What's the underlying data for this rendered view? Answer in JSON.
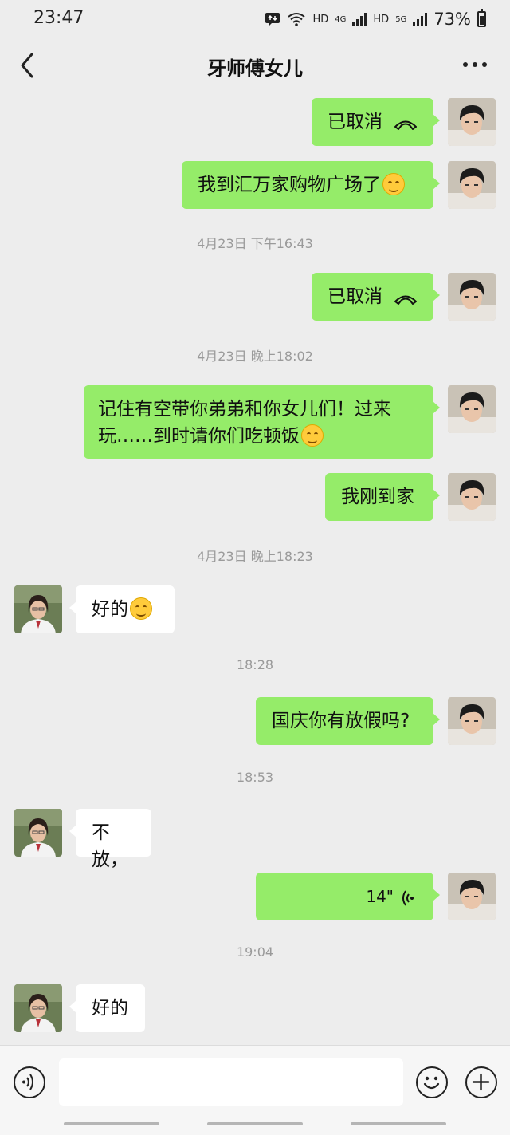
{
  "status_bar": {
    "time": "23:47",
    "hd1": "HD",
    "net1": "4G",
    "hd2": "HD",
    "net2": "5G",
    "battery": "73%"
  },
  "header": {
    "title": "牙师傅女儿"
  },
  "messages": [
    {
      "from": "me",
      "type": "call",
      "text": "已取消"
    },
    {
      "from": "me",
      "type": "text",
      "text": "我到汇万家购物广场了",
      "emoji": true
    },
    {
      "type": "time",
      "text": "4月23日 下午16:43"
    },
    {
      "from": "me",
      "type": "call",
      "text": "已取消"
    },
    {
      "type": "time",
      "text": "4月23日 晚上18:02"
    },
    {
      "from": "me",
      "type": "text",
      "lines": [
        "记住有空带你弟弟和你女儿们！过来",
        "玩……到时请你们吃顿饭"
      ],
      "emoji": true
    },
    {
      "from": "me",
      "type": "text",
      "text": "我刚到家"
    },
    {
      "type": "time",
      "text": "4月23日 晚上18:23"
    },
    {
      "from": "her",
      "type": "text",
      "text": "好的",
      "emoji": true
    },
    {
      "type": "time",
      "text": "18:28"
    },
    {
      "from": "me",
      "type": "text",
      "text": "国庆你有放假吗?"
    },
    {
      "type": "time",
      "text": "18:53"
    },
    {
      "from": "her",
      "type": "text",
      "text": "不放，"
    },
    {
      "from": "me",
      "type": "voice",
      "text": "14\""
    },
    {
      "type": "time",
      "text": "19:04"
    },
    {
      "from": "her",
      "type": "text",
      "text": "好的"
    }
  ],
  "colors": {
    "outgoing_bubble": "#95ec69",
    "incoming_bubble": "#ffffff",
    "background": "#ededed"
  },
  "icons": [
    "back-arrow-icon",
    "more-icon",
    "phone-hangup-icon",
    "voice-wave-icon",
    "voice-mode-icon",
    "emoji-icon",
    "plus-icon",
    "smile-emoji-icon"
  ]
}
